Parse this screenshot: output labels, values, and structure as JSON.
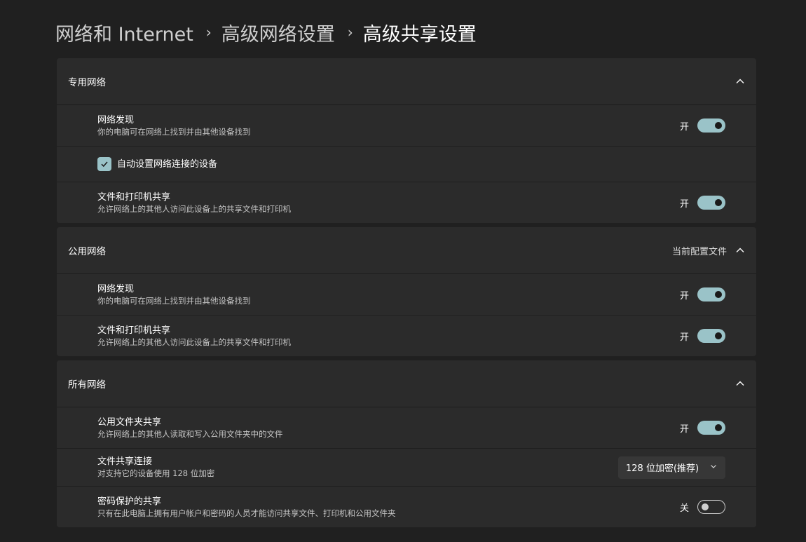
{
  "breadcrumb": {
    "items": [
      "网络和 Internet",
      "高级网络设置",
      "高级共享设置"
    ],
    "separator": "›"
  },
  "colors": {
    "accent": "#9ac3c8",
    "background": "#202020",
    "card": "#2b2b2b"
  },
  "private_network": {
    "title": "专用网络",
    "network_discovery": {
      "title": "网络发现",
      "description": "你的电脑可在网络上找到并由其他设备找到",
      "state": "开",
      "on": true
    },
    "auto_setup": {
      "label": "自动设置网络连接的设备",
      "checked": true
    },
    "file_printer_sharing": {
      "title": "文件和打印机共享",
      "description": "允许网络上的其他人访问此设备上的共享文件和打印机",
      "state": "开",
      "on": true
    }
  },
  "public_network": {
    "title": "公用网络",
    "badge": "当前配置文件",
    "network_discovery": {
      "title": "网络发现",
      "description": "你的电脑可在网络上找到并由其他设备找到",
      "state": "开",
      "on": true
    },
    "file_printer_sharing": {
      "title": "文件和打印机共享",
      "description": "允许网络上的其他人访问此设备上的共享文件和打印机",
      "state": "开",
      "on": true
    }
  },
  "all_networks": {
    "title": "所有网络",
    "public_folder_sharing": {
      "title": "公用文件夹共享",
      "description": "允许网络上的其他人读取和写入公用文件夹中的文件",
      "state": "开",
      "on": true
    },
    "file_sharing_connections": {
      "title": "文件共享连接",
      "description": "对支持它的设备使用 128 位加密",
      "selected": "128 位加密(推荐)"
    },
    "password_protected": {
      "title": "密码保护的共享",
      "description": "只有在此电脑上拥有用户帐户和密码的人员才能访问共享文件、打印机和公用文件夹",
      "state": "关",
      "on": false
    }
  },
  "icons": {
    "collapse": "chevron-up-icon",
    "dropdown": "chevron-down-icon",
    "check": "check-icon"
  }
}
